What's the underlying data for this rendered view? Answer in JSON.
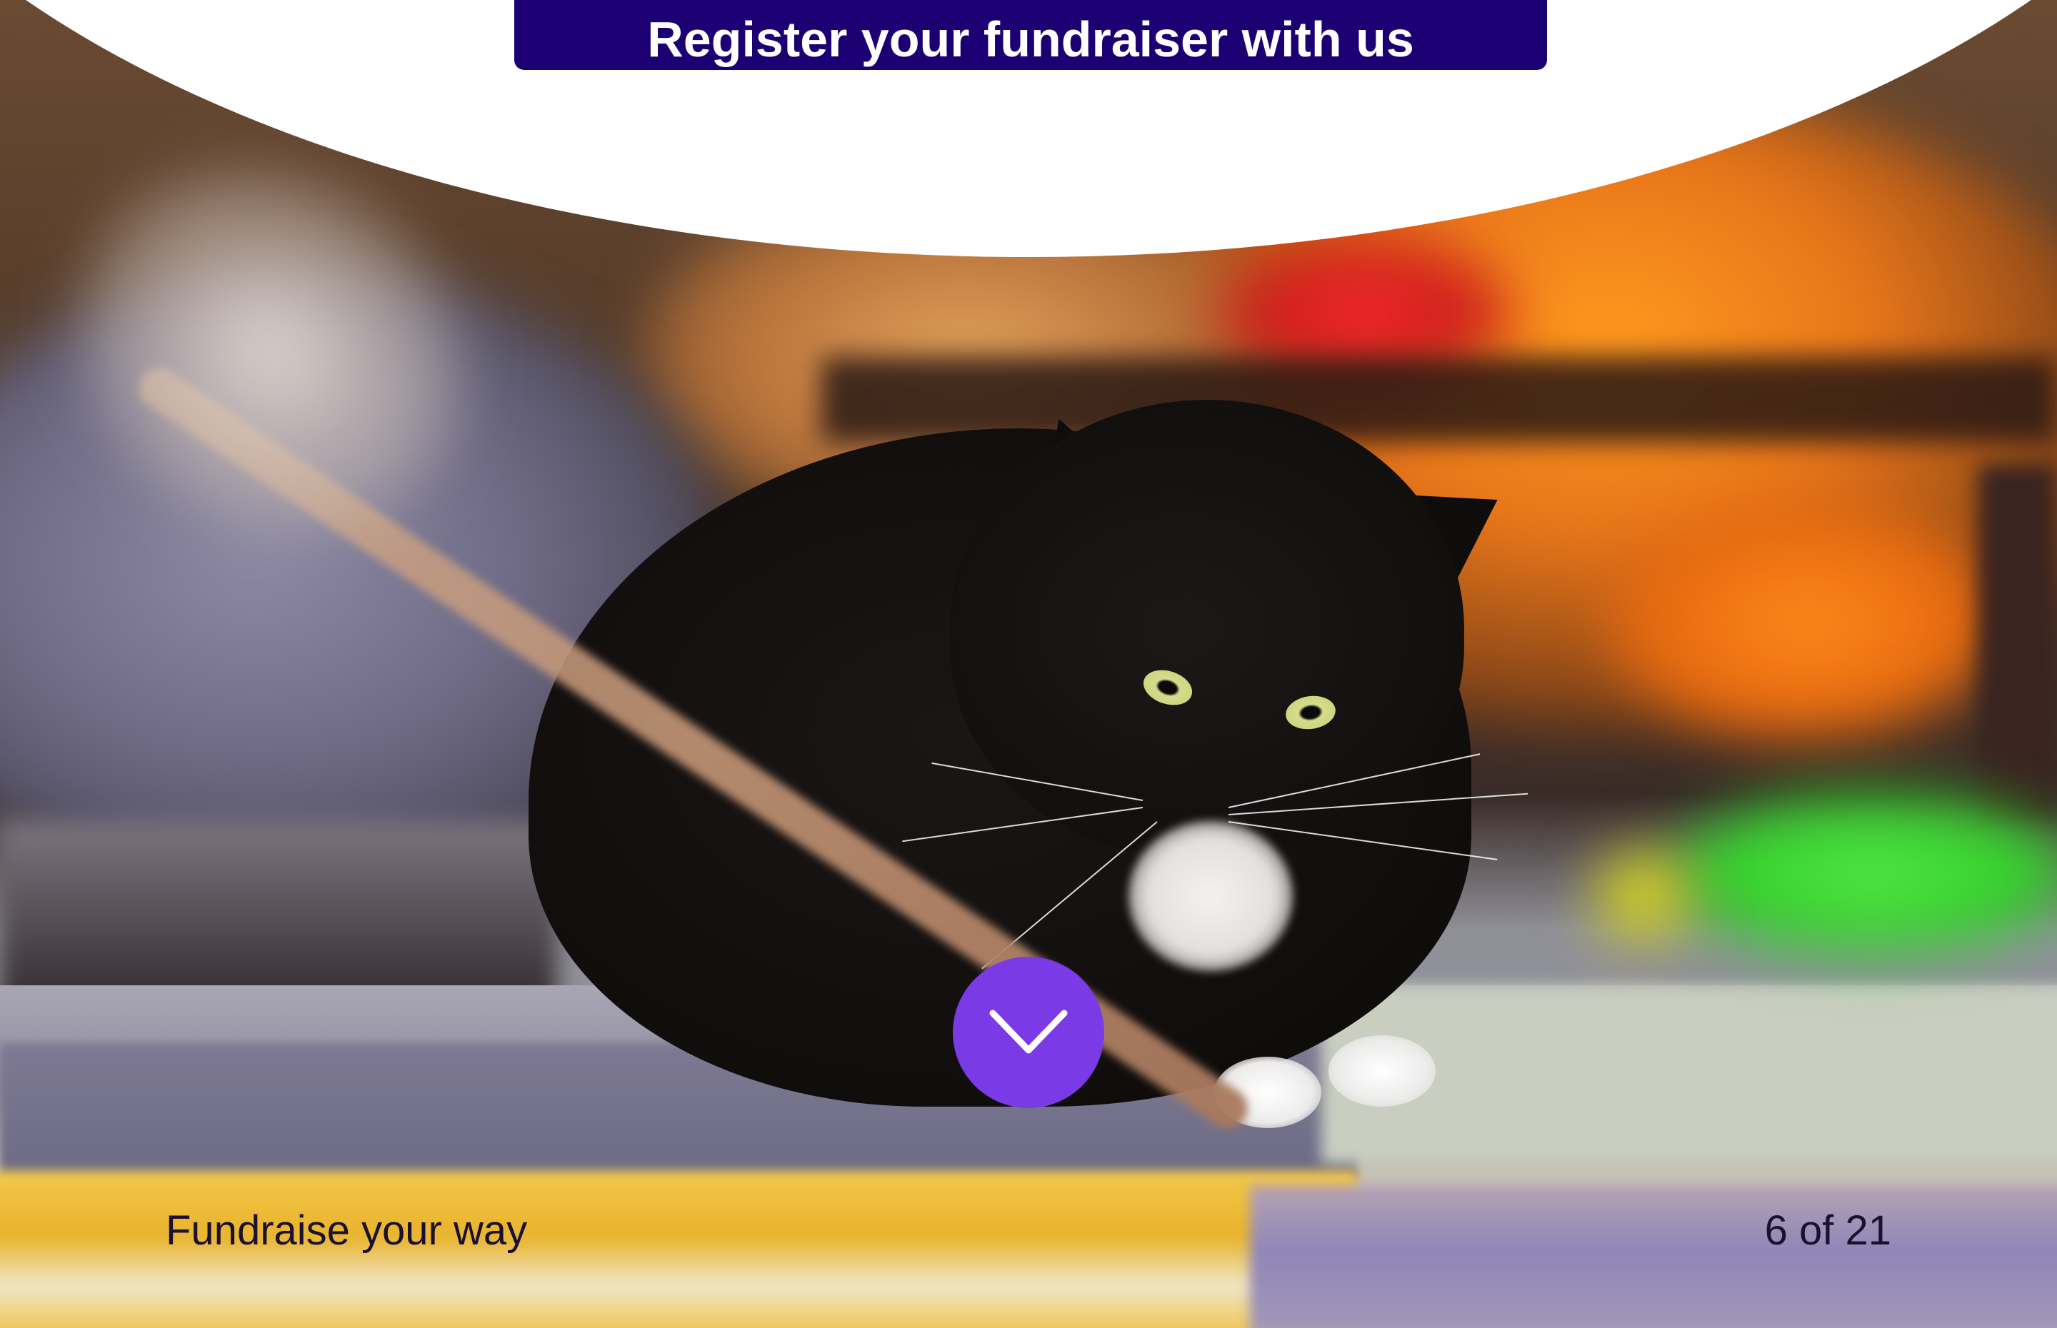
{
  "cta": {
    "label": "Register your fundraiser with us"
  },
  "hero": {
    "image_alt": "Black and white cat playing with a wand toy",
    "scroll_icon": "chevron-down-icon"
  },
  "footer": {
    "caption": "Fundraise your way",
    "counter": "6 of 21"
  },
  "colors": {
    "cta_background": "#1c0073",
    "scroll_button": "#7a3ae6",
    "text": "#1a1030"
  }
}
